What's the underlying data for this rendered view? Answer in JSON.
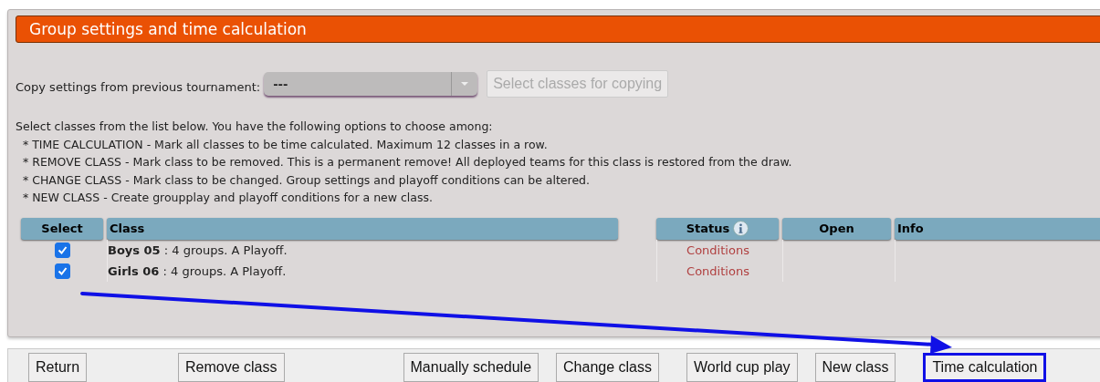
{
  "panel": {
    "title": "Group settings and time calculation"
  },
  "copy": {
    "label": "Copy settings from previous tournament:",
    "dropdown": {
      "value": "---"
    },
    "button": {
      "label": "Select classes for copying",
      "disabled": true
    }
  },
  "instructions": [
    "Select classes from the list below. You have the following options to choose among:",
    "* TIME CALCULATION - Mark all classes to be time calculated. Maximum 12 classes in a row.",
    "* REMOVE CLASS - Mark class to be removed. This is a permanent remove! All deployed teams for this class is restored from the draw.",
    "* CHANGE CLASS - Mark class to be changed. Group settings and playoff conditions can be altered.",
    "* NEW CLASS - Create groupplay and playoff conditions for a new class."
  ],
  "table": {
    "columns": [
      {
        "label": "Select",
        "kind": "select"
      },
      {
        "label": "Class",
        "kind": "class"
      },
      {
        "label": "Status",
        "kind": "status"
      },
      {
        "label": "Open",
        "kind": "open"
      },
      {
        "label": "Info",
        "kind": "info"
      }
    ],
    "rows": [
      {
        "checked": true,
        "class": "**Boys 05** : 4 groups. A Playoff.",
        "status": "Conditions"
      },
      {
        "checked": true,
        "class": "**Girls 06** : 4 groups. A Playoff.",
        "status": "Conditions"
      }
    ]
  },
  "buttons": [
    {
      "label": "Return",
      "highlighted": false
    },
    {
      "label": "Remove class",
      "highlighted": false
    },
    {
      "label": "Manually schedule",
      "highlighted": false
    },
    {
      "label": "Change class",
      "highlighted": false
    },
    {
      "label": "World cup play",
      "highlighted": false
    },
    {
      "label": "New class",
      "highlighted": false
    },
    {
      "label": "Time calculation",
      "highlighted": true
    }
  ]
}
